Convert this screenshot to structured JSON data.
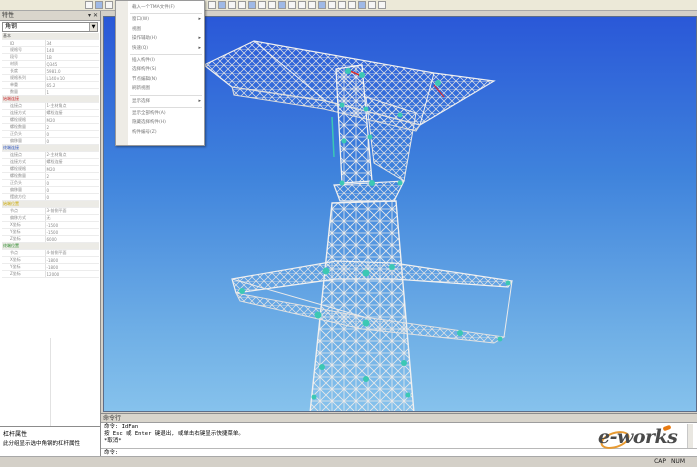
{
  "properties_panel": {
    "title": "特性",
    "title_controls": "▾ ✕",
    "selector": "角钢",
    "categories": [
      {
        "label": "基本",
        "color": "#555",
        "rows": [
          [
            "ID",
            "34"
          ],
          [
            "规格号",
            "140"
          ],
          [
            "段号",
            "1B"
          ],
          [
            "材质",
            "Q345"
          ],
          [
            "长度",
            "5981.0"
          ],
          [
            "规格系列",
            "L140×10"
          ],
          [
            "单重",
            "65.2"
          ],
          [
            "数量",
            "1"
          ]
        ]
      },
      {
        "label": "始端连接",
        "color": "#c8282c",
        "rows": [
          [
            "连接点",
            "1-主材角点"
          ],
          [
            "连接方式",
            "螺栓连接"
          ],
          [
            "螺栓规格",
            "M20"
          ],
          [
            "螺栓数量",
            "2"
          ],
          [
            "正负头",
            "0"
          ],
          [
            "偏移量",
            "0"
          ]
        ]
      },
      {
        "label": "终端连接",
        "color": "#2a52c0",
        "rows": [
          [
            "连接点",
            "2-主材角点"
          ],
          [
            "连接方式",
            "螺栓连接"
          ],
          [
            "螺栓规格",
            "M20"
          ],
          [
            "螺栓数量",
            "2"
          ],
          [
            "正负头",
            "0"
          ],
          [
            "偏移量",
            "0"
          ],
          [
            "摆放方位",
            "0"
          ]
        ]
      },
      {
        "label": "始端位置",
        "color": "#caa800",
        "rows": [
          [
            "节点",
            "3-前侧平面"
          ],
          [
            "偏移方式",
            "无"
          ],
          [
            "X坐标",
            "-1500"
          ],
          [
            "Y坐标",
            "-1500"
          ],
          [
            "Z坐标",
            "6000"
          ]
        ]
      },
      {
        "label": "终端位置",
        "color": "#2a8a2a",
        "rows": [
          [
            "节点",
            "4-前侧平面"
          ],
          [
            "X坐标",
            "-1800"
          ],
          [
            "Y坐标",
            "-1800"
          ],
          [
            "Z坐标",
            "12000"
          ]
        ]
      }
    ],
    "description_title": "杠杆属性",
    "description_text": "此分组显示选中角钢的杠杆属性"
  },
  "context_menu": {
    "items": [
      {
        "label": "载入一个TMA文件(F)",
        "submenu": false
      },
      {
        "label": "窗口(W)",
        "submenu": true
      },
      {
        "label": "视图",
        "submenu": false
      },
      {
        "label": "操作辅助(H)",
        "submenu": true
      },
      {
        "label": "快速(Q)",
        "submenu": true
      },
      {
        "label": "插入构件(I)",
        "submenu": false
      },
      {
        "label": "选择构件(S)",
        "submenu": false
      },
      {
        "label": "节点编辑(N)",
        "submenu": false
      },
      {
        "label": "刷新视图",
        "submenu": false
      },
      {
        "label": "显示选择",
        "submenu": true
      },
      {
        "label": "显示全部构件(A)",
        "submenu": false
      },
      {
        "label": "隐藏选择构件(H)",
        "submenu": false
      },
      {
        "label": "构件编号(Z)",
        "submenu": false
      }
    ]
  },
  "command": {
    "title": "命令行",
    "lines": [
      "命令: IdFan",
      "按 Esc 或 Enter 键退出, 或单击右键显示快捷菜单。",
      "*取消*"
    ],
    "prompt": "命令:"
  },
  "status": {
    "cap": "CAP",
    "num": "NUM"
  },
  "watermark": {
    "brand": "e-works"
  },
  "colors": {
    "viewport_top": "#2a58d8",
    "viewport_bottom": "#86c2ec",
    "tower": "#e8e8e8",
    "node": "#3cc8b4"
  }
}
